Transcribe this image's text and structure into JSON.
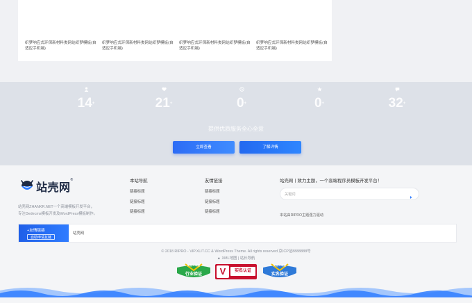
{
  "products": [
    {
      "title": "织梦响应式环保新材料类网站织梦模板(自适应手机端)"
    },
    {
      "title": "织梦响应式环保新材料类网站织梦模板(自适应手机端)"
    },
    {
      "title": "织梦响应式环保新材料类网站织梦模板(自适应手机端)"
    },
    {
      "title": "织梦响应式环保新材料类网站织梦模板(自适应手机端)"
    }
  ],
  "stats": {
    "items": [
      {
        "icon": "user-icon",
        "value": "14"
      },
      {
        "icon": "heart-icon",
        "value": "21"
      },
      {
        "icon": "clock-icon",
        "value": "0"
      },
      {
        "icon": "star-icon",
        "value": "0"
      },
      {
        "icon": "chat-icon",
        "value": "32"
      }
    ],
    "caption": "提供优质服务全心全意",
    "btn_primary": "立即查看",
    "btn_secondary": "了解详情"
  },
  "footer": {
    "logo_text": "站壳网",
    "logo_reg": "®",
    "description_line1": "站壳网ZHANKR.NET一个高端模板开发平台，",
    "description_line2": "专注Dedecms模板开发及WordPress模板制作。",
    "nav_title": "本站导航",
    "nav_links": [
      "链接标题",
      "链接标题",
      "链接标题"
    ],
    "friend_title": "友情链接",
    "friend_links": [
      "链接标题",
      "链接标题",
      "链接标题"
    ],
    "search_title": "站壳网丨致力主题，一个高端程序员模板开发平台！",
    "search_placeholder": "关键词",
    "search_note": "本站由RIPRO主题强力驱动",
    "link_tab_label": "+友情链接",
    "link_tab_sub": "自助申请友链",
    "link_items": [
      "站壳网"
    ],
    "copyright": "© 2018 RIPRO - VIP.XLIT.CC & WordPress Theme. All rights reserved 京ICP证8888888号",
    "sublinks": "XML地图 | 站长导航",
    "badges": [
      {
        "top": "安全  V  联盟",
        "main": "行业验证",
        "color": "#2aa84a"
      },
      {
        "top": "",
        "main": "实名认证",
        "color": "#c8102e"
      },
      {
        "top": "安全  V  联盟",
        "main": "实名验证",
        "color": "#2f7ad8"
      }
    ],
    "accent": "#2f7cff"
  }
}
